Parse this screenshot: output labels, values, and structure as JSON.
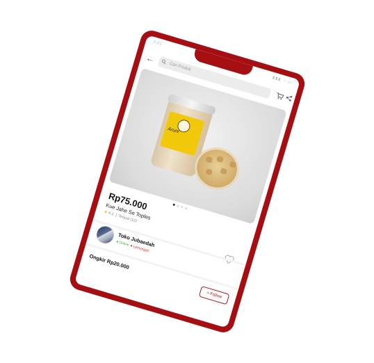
{
  "status_bar": {
    "time": "9:41",
    "icons": "▮▮▮ ◔ ▭"
  },
  "search": {
    "placeholder": "Cari Produk"
  },
  "product": {
    "image_label": "Aruni",
    "price": "Rp75.000",
    "name": "Kue Jahe Se Toples",
    "rating": "4.3",
    "sold": "Terjual (10)"
  },
  "carousel": {
    "count": 4,
    "active": 1
  },
  "shop": {
    "name": "Toko Jubaedah",
    "status": "Online",
    "location": "Lemongan"
  },
  "shipping": {
    "label": "Ongkir Rp20.000"
  },
  "follow": {
    "label": "+ Follow"
  },
  "colors": {
    "accent": "#a50f12",
    "online": "#39a845"
  },
  "icons": [
    "back-icon",
    "search-icon",
    "cart-icon",
    "share-icon",
    "star-icon",
    "heart-icon"
  ]
}
